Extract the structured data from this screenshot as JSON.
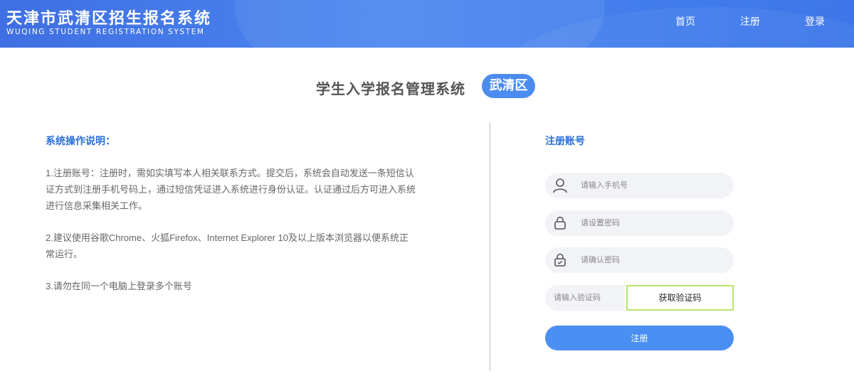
{
  "header": {
    "title": "天津市武清区招生报名系统",
    "subtitle": "WUQING STUDENT REGISTRATION SYSTEM",
    "nav": [
      {
        "label": "首页"
      },
      {
        "label": "注册"
      },
      {
        "label": "登录"
      }
    ]
  },
  "heading": {
    "title": "学生入学报名管理系统",
    "badge": "武清区"
  },
  "instructions": {
    "title": "系统操作说明：",
    "items": [
      "1.注册账号：注册时，需如实填写本人相关联系方式。提交后，系统会自动发送一条短信认证方式到注册手机号码上，通过短信凭证进入系统进行身份认证。认证通过后方可进入系统进行信息采集相关工作。",
      "2.建议使用谷歌Chrome、火狐Firefox、Internet Explorer 10及以上版本浏览器以便系统正常运行。",
      "3.请勿在同一个电脑上登录多个账号"
    ]
  },
  "form": {
    "title": "注册账号",
    "phone_placeholder": "请输入手机号",
    "password_placeholder": "请设置密码",
    "confirm_placeholder": "请确认密码",
    "captcha_placeholder": "请输入验证码",
    "get_code_label": "获取验证码",
    "submit_label": "注册"
  },
  "colors": {
    "header_blue": "#4a86f0",
    "accent_blue": "#2a6fd6",
    "button_blue": "#4a8ff2",
    "captcha_border": "#b5e66a"
  }
}
